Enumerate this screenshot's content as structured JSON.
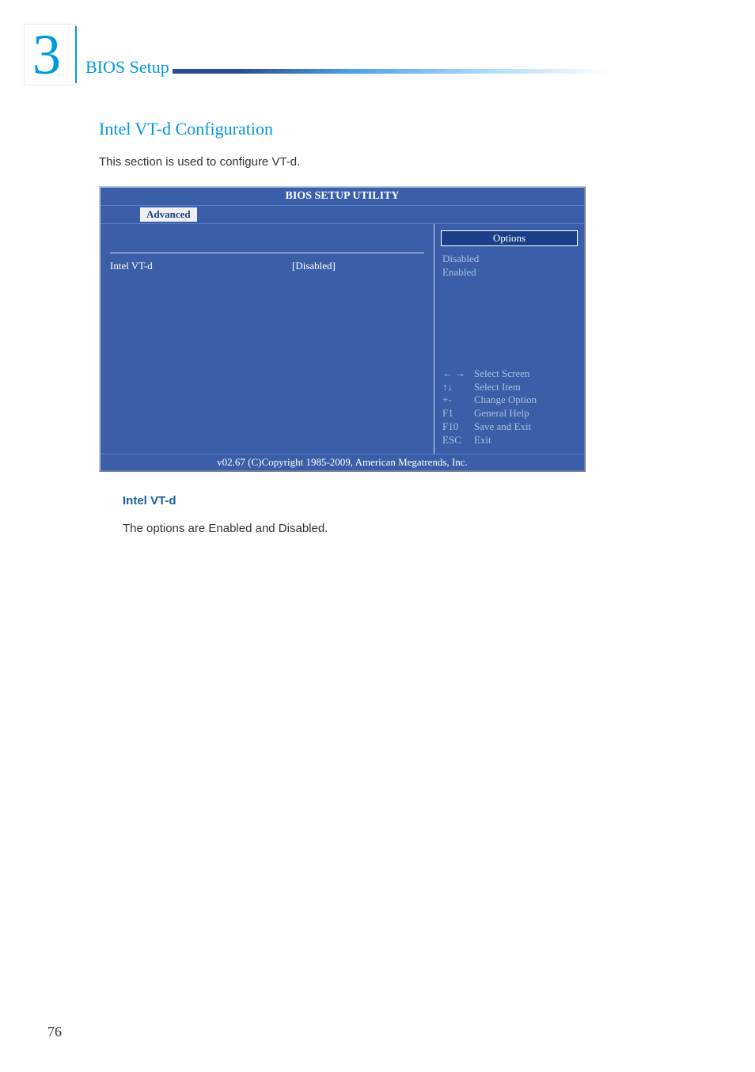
{
  "header": {
    "chapter_number": "3",
    "chapter_title": "BIOS Setup"
  },
  "section": {
    "title": "Intel VT-d Configuration",
    "description": "This section is used to configure VT-d."
  },
  "bios": {
    "title": "BIOS SETUP UTILITY",
    "tab": "Advanced",
    "setting_label": "Intel VT-d",
    "setting_value": "[Disabled]",
    "options_header": "Options",
    "options": [
      "Disabled",
      "Enabled"
    ],
    "help": [
      {
        "key": "← →",
        "desc": "Select Screen"
      },
      {
        "key": "↑↓",
        "desc": "Select Item"
      },
      {
        "key": "+-",
        "desc": "Change Option"
      },
      {
        "key": "F1",
        "desc": "General Help"
      },
      {
        "key": "F10",
        "desc": "Save and Exit"
      },
      {
        "key": "ESC",
        "desc": "Exit"
      }
    ],
    "footer": "v02.67 (C)Copyright 1985-2009, American Megatrends, Inc."
  },
  "field": {
    "label": "Intel VT-d",
    "description": "The options are Enabled and Disabled."
  },
  "page_number": "76"
}
